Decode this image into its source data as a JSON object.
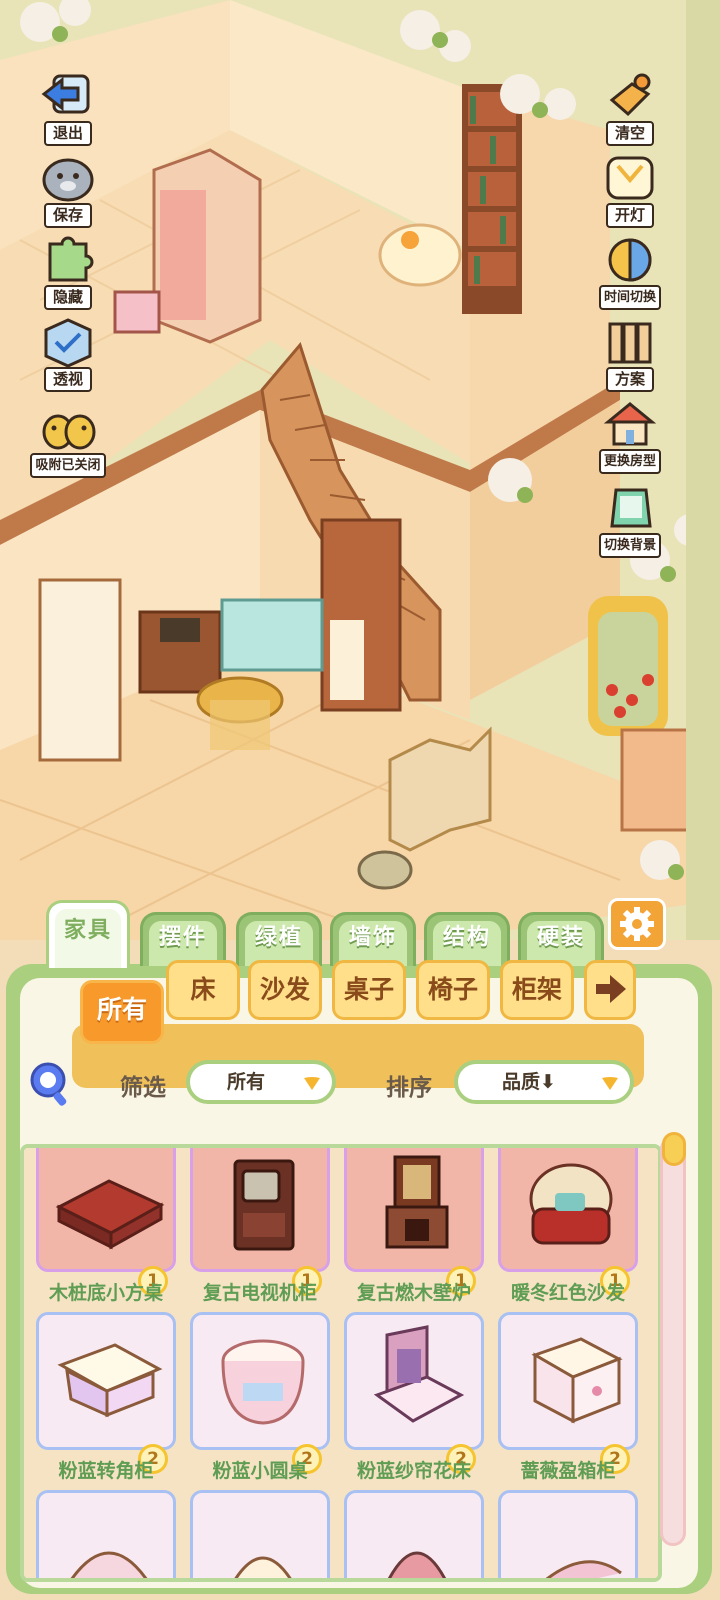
{
  "colors": {
    "accent_green": "#a9cf7f",
    "accent_orange": "#f79a2b",
    "item_name_green": "#5f9d54",
    "rarity1_bg": "#f2b6a8",
    "rarity2_bg": "#f8eaf2"
  },
  "left_tools": [
    {
      "label": "退出",
      "icon": "exit-arrow-icon"
    },
    {
      "label": "保存",
      "icon": "hamster-save-icon"
    },
    {
      "label": "隐藏",
      "icon": "hide-puzzle-icon"
    },
    {
      "label": "透视",
      "icon": "perspective-cube-icon"
    },
    {
      "label": "吸附已关闭",
      "icon": "snap-birds-icon"
    }
  ],
  "right_tools": [
    {
      "label": "清空",
      "icon": "clear-broom-icon"
    },
    {
      "label": "开灯",
      "icon": "light-lamp-icon"
    },
    {
      "label": "时间切换",
      "icon": "time-switch-icon"
    },
    {
      "label": "方案",
      "icon": "scheme-boards-icon"
    },
    {
      "label": "更换房型",
      "icon": "house-type-icon"
    },
    {
      "label": "切换背景",
      "icon": "background-switch-icon"
    }
  ],
  "main_tabs": [
    "家具",
    "摆件",
    "绿植",
    "墙饰",
    "结构",
    "硬装"
  ],
  "active_main_tab": "家具",
  "sub_tabs": [
    "所有",
    "床",
    "沙发",
    "桌子",
    "椅子",
    "柜架"
  ],
  "active_sub_tab": "所有",
  "filter": {
    "label": "筛选",
    "value": "所有"
  },
  "sort": {
    "label": "排序",
    "value": "品质⬇"
  },
  "items": [
    {
      "name": "木桩底小方桌",
      "rarity": "1",
      "icon": "red-square-table-icon"
    },
    {
      "name": "复古电视机柜",
      "rarity": "1",
      "icon": "retro-tv-cabinet-icon"
    },
    {
      "name": "复古燃木壁炉",
      "rarity": "1",
      "icon": "retro-fireplace-icon"
    },
    {
      "name": "暖冬红色沙发",
      "rarity": "1",
      "icon": "red-armchair-icon"
    },
    {
      "name": "粉蓝转角柜",
      "rarity": "2",
      "icon": "corner-cabinet-icon"
    },
    {
      "name": "粉蓝小圆桌",
      "rarity": "2",
      "icon": "round-table-icon"
    },
    {
      "name": "粉蓝纱帘花床",
      "rarity": "2",
      "icon": "canopy-bed-icon"
    },
    {
      "name": "蔷薇盈箱柜",
      "rarity": "2",
      "icon": "rose-chest-icon"
    }
  ],
  "partial_items": [
    {
      "icon": "partial-item-icon"
    },
    {
      "icon": "partial-item-icon"
    },
    {
      "icon": "partial-item-icon"
    },
    {
      "icon": "partial-item-icon"
    }
  ]
}
